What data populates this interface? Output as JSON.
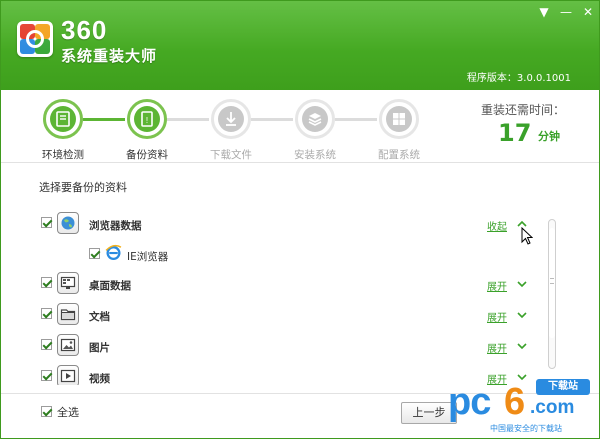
{
  "app": {
    "brand_number": "360",
    "brand_name": "系统重装大师",
    "version": "程序版本：3.0.0.1001"
  },
  "window_controls": {
    "menu": "▼",
    "minimize": "—",
    "close": "✕"
  },
  "steps": [
    {
      "label": "环境检测",
      "state": "done"
    },
    {
      "label": "备份资料",
      "state": "current"
    },
    {
      "label": "下载文件",
      "state": "todo"
    },
    {
      "label": "安装系统",
      "state": "todo"
    },
    {
      "label": "配置系统",
      "state": "todo"
    }
  ],
  "remaining": {
    "title": "重装还需时间：",
    "value": "17",
    "unit": "分钟"
  },
  "content": {
    "section_title": "选择要备份的资料",
    "items": [
      {
        "label": "浏览器数据",
        "toggle": "收起",
        "checked": true,
        "icon": "globe-icon"
      },
      {
        "label": "IE浏览器",
        "checked": true,
        "icon": "ie-icon",
        "sub": true
      },
      {
        "label": "桌面数据",
        "toggle": "展开",
        "checked": true,
        "icon": "desktop-icon"
      },
      {
        "label": "文档",
        "toggle": "展开",
        "checked": true,
        "icon": "folder-icon"
      },
      {
        "label": "图片",
        "toggle": "展开",
        "checked": true,
        "icon": "picture-icon"
      },
      {
        "label": "视频",
        "toggle": "展开",
        "checked": true,
        "icon": "video-icon"
      }
    ]
  },
  "footer": {
    "select_all": "全选",
    "prev_button": "上一步"
  },
  "watermark": {
    "pc": "pc",
    "six": "6",
    "com": ".com",
    "tag": "下载站",
    "sub": "中国最安全的下载站"
  },
  "colors": {
    "brand_green": "#3e9f1c",
    "accent_green": "#5cb534",
    "step_inactive": "#c8c8c8"
  }
}
